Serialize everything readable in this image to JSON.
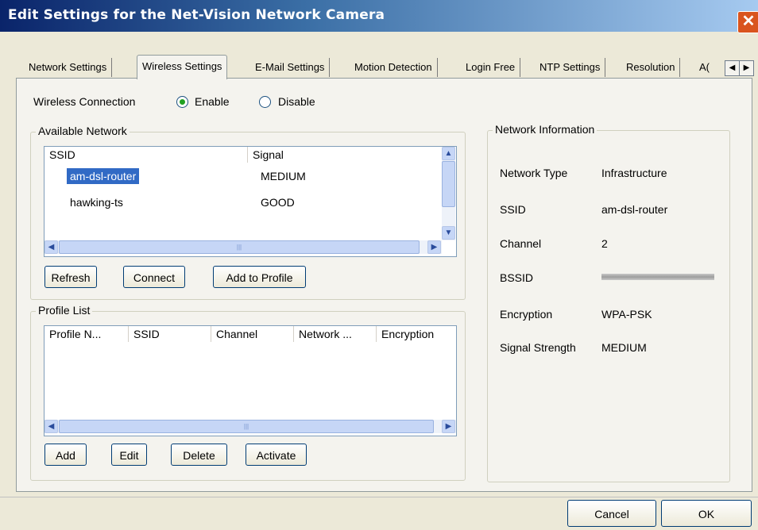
{
  "window": {
    "title": "Edit Settings for the Net-Vision Network Camera",
    "close_glyph": "✕"
  },
  "tabs": [
    "Network Settings",
    "Wireless Settings",
    "E-Mail Settings",
    "Motion Detection",
    "Login Free",
    "NTP Settings",
    "Resolution",
    "A("
  ],
  "active_tab": "Wireless Settings",
  "tab_scroll": {
    "left": "◀",
    "right": "▶"
  },
  "wireless": {
    "label": "Wireless Connection",
    "enable": "Enable",
    "disable": "Disable",
    "selected": "Enable"
  },
  "available_network": {
    "title": "Available Network",
    "columns": [
      "SSID",
      "Signal"
    ],
    "rows": [
      {
        "ssid": "am-dsl-router",
        "signal": "MEDIUM",
        "selected": true
      },
      {
        "ssid": "hawking-ts",
        "signal": "GOOD",
        "selected": false
      }
    ],
    "buttons": {
      "refresh": "Refresh",
      "connect": "Connect",
      "add_to_profile": "Add to Profile"
    }
  },
  "profile_list": {
    "title": "Profile List",
    "columns": [
      "Profile N...",
      "SSID",
      "Channel",
      "Network ...",
      "Encryption"
    ],
    "rows": [],
    "buttons": {
      "add": "Add",
      "edit": "Edit",
      "delete": "Delete",
      "activate": "Activate"
    }
  },
  "network_info": {
    "title": "Network Information",
    "fields": [
      {
        "label": "Network Type",
        "value": "Infrastructure"
      },
      {
        "label": "SSID",
        "value": "am-dsl-router"
      },
      {
        "label": "Channel",
        "value": "2"
      },
      {
        "label": "BSSID",
        "value": ""
      },
      {
        "label": "Encryption",
        "value": "WPA-PSK"
      },
      {
        "label": "Signal Strength",
        "value": "MEDIUM"
      }
    ]
  },
  "footer": {
    "cancel": "Cancel",
    "ok": "OK"
  },
  "scroll_glyphs": {
    "up": "▲",
    "down": "▼",
    "left": "◀",
    "right": "▶",
    "grip": "|||"
  },
  "colors": {
    "selection": "#316ac5",
    "titlebar_start": "#0a246a",
    "titlebar_end": "#a6caf0"
  }
}
